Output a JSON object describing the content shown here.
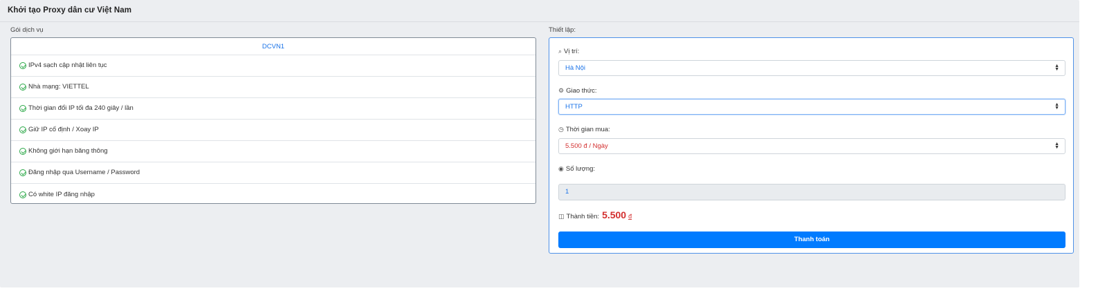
{
  "page": {
    "title": "Khởi tạo Proxy dân cư Việt Nam"
  },
  "service": {
    "label": "Gói dịch vụ",
    "name": "DCVN1",
    "features": [
      "IPv4 sạch cập nhật liên tục",
      "Nhà mạng: VIETTEL",
      "Thời gian đổi IP tối đa 240 giây / lần",
      "Giữ IP cố định / Xoay IP",
      "Không giới hạn băng thông",
      "Đăng nhập qua Username / Password",
      "Có white IP đăng nhập"
    ]
  },
  "settings": {
    "label": "Thiết lập:",
    "location": {
      "label": "Vị trí:",
      "value": "Hà Nội",
      "icon": "search-icon"
    },
    "protocol": {
      "label": "Giao thức:",
      "value": "HTTP",
      "icon": "gears-icon"
    },
    "duration": {
      "label": "Thời gian mua:",
      "value": "5.500 đ / Ngày",
      "icon": "clock-icon"
    },
    "quantity": {
      "label": "Số lượng:",
      "value": "1",
      "icon": "stack-icon"
    },
    "total": {
      "label": "Thành tiền:",
      "value": "5.500",
      "currency": "đ",
      "icon": "trash-icon"
    },
    "pay_label": "Thanh toán"
  },
  "colors": {
    "accent": "#007bff",
    "link": "#1a73e8",
    "price": "#d32f2f",
    "check": "#28a745"
  }
}
